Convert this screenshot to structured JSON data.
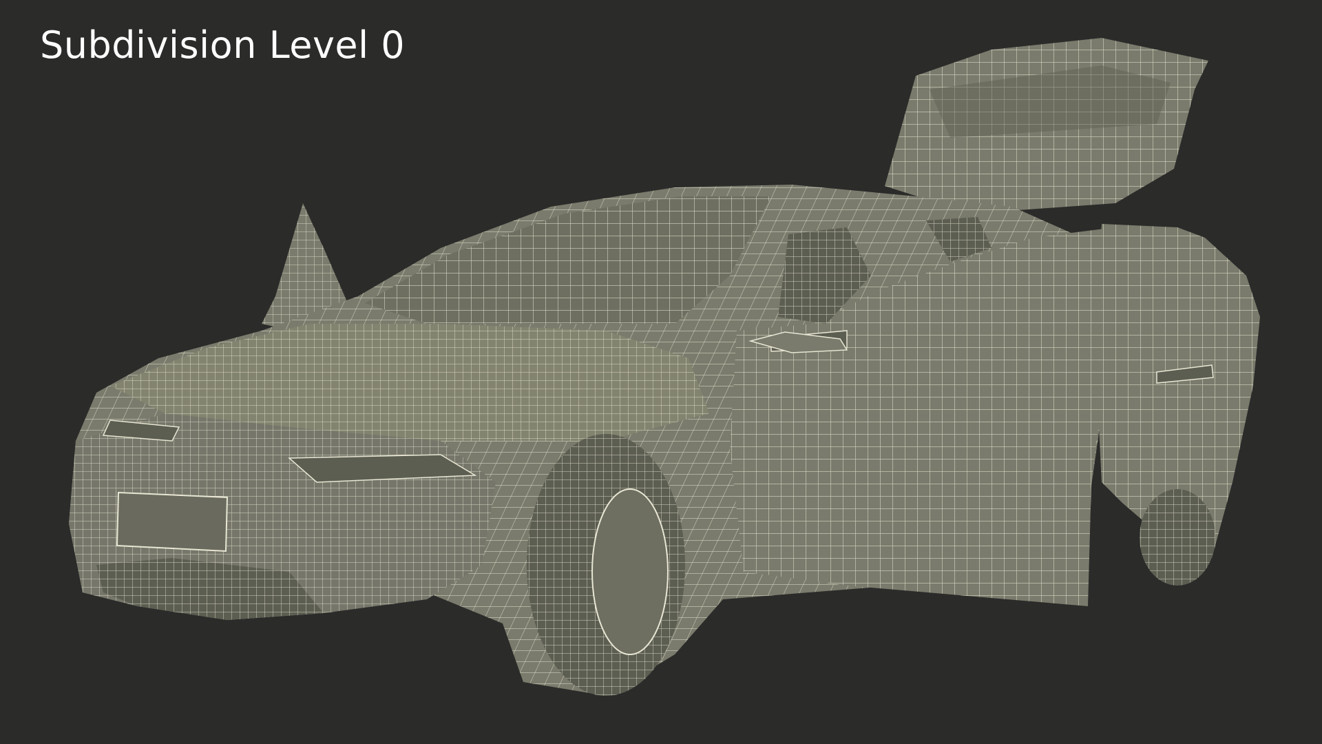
{
  "viewport": {
    "background": "#2b2b2a",
    "label": "Subdivision Level 0"
  },
  "render": {
    "subject": "car-wireframe",
    "body_color": "#7a7b6c",
    "shadow_color": "#5d5e52",
    "wire_color": "#e9e7d4"
  }
}
